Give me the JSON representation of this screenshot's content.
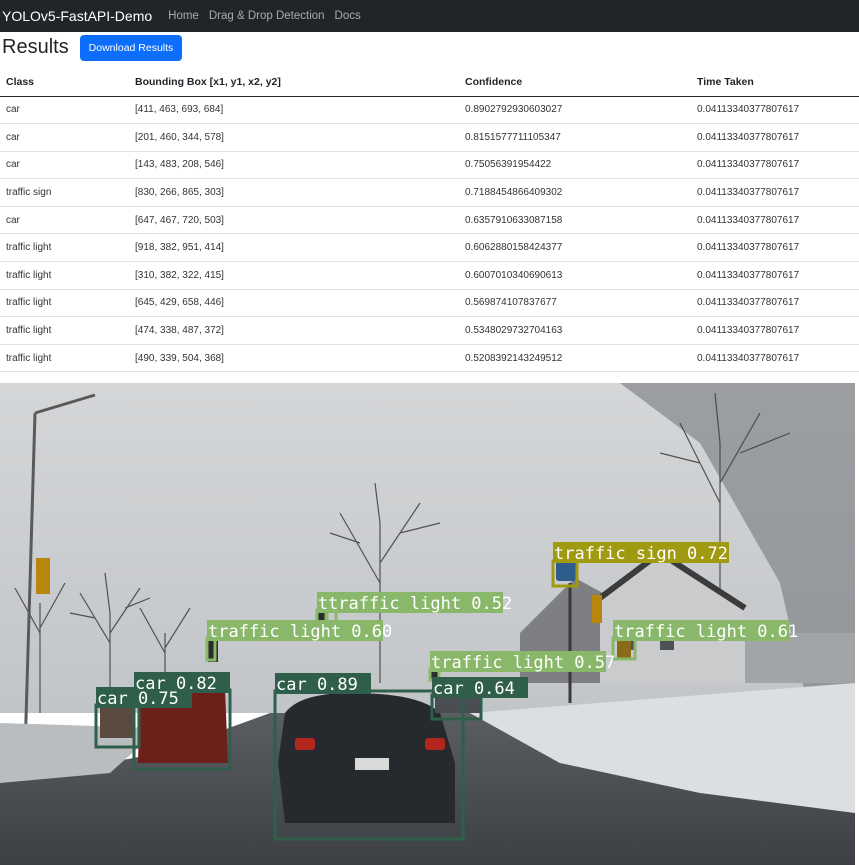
{
  "navbar": {
    "brand": "YOLOv5-FastAPI-Demo",
    "links": [
      "Home",
      "Drag & Drop Detection",
      "Docs"
    ]
  },
  "header": {
    "title": "Results",
    "download_label": "Download Results"
  },
  "colors": {
    "navbar_bg": "#212529",
    "primary": "#0d6efd",
    "box_car": "#2f5e4a",
    "box_traffic_light": "#8ab86a",
    "box_traffic_sign": "#a09a10"
  },
  "table": {
    "columns": [
      "Class",
      "Bounding Box [x1, y1, x2, y2]",
      "Confidence",
      "Time Taken"
    ],
    "rows": [
      [
        "car",
        "[411, 463, 693, 684]",
        "0.8902792930603027",
        "0.04113340377807617"
      ],
      [
        "car",
        "[201, 460, 344, 578]",
        "0.8151577711105347",
        "0.04113340377807617"
      ],
      [
        "car",
        "[143, 483, 208, 546]",
        "0.75056391954422",
        "0.04113340377807617"
      ],
      [
        "traffic sign",
        "[830, 266, 865, 303]",
        "0.7188454866409302",
        "0.04113340377807617"
      ],
      [
        "car",
        "[647, 467, 720, 503]",
        "0.6357910633087158",
        "0.04113340377807617"
      ],
      [
        "traffic light",
        "[918, 382, 951, 414]",
        "0.6062880158424377",
        "0.04113340377807617"
      ],
      [
        "traffic light",
        "[310, 382, 322, 415]",
        "0.6007010340690613",
        "0.04113340377807617"
      ],
      [
        "traffic light",
        "[645, 429, 658, 446]",
        "0.569874107837677",
        "0.04113340377807617"
      ],
      [
        "traffic light",
        "[474, 338, 487, 372]",
        "0.5348029732704163",
        "0.04113340377807617"
      ],
      [
        "traffic light",
        "[490, 339, 504, 368]",
        "0.5208392143249512",
        "0.04113340377807617"
      ]
    ]
  },
  "detections": {
    "labels": [
      "car 0.89",
      "car 0.82",
      "car 0.75",
      "traffic sign 0.72",
      "car 0.64",
      "traffic light 0.61",
      "traffic light 0.60",
      "traffic light 0.57",
      "traffic light 0.52",
      "t"
    ]
  }
}
